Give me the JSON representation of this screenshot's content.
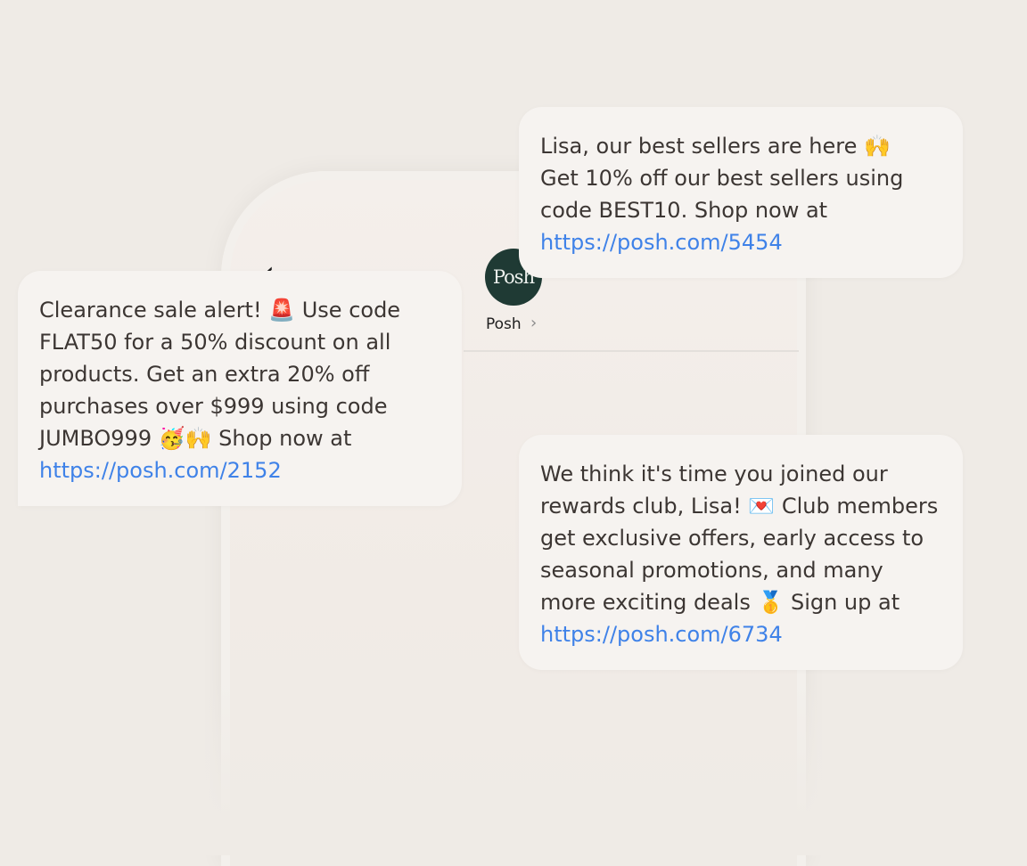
{
  "contact": {
    "avatar_text": "Posh",
    "name": "Posh",
    "chevron": "›",
    "back": "‹"
  },
  "messages": [
    {
      "lines": [
        "Lisa, our best sellers are here 🙌",
        "Get 10% off our best sellers using",
        "code BEST10. Shop now at"
      ],
      "link": "https://posh.com/5454"
    },
    {
      "lines": [
        "Clearance sale alert! 🚨 Use code",
        "FLAT50 for a 50% discount on all",
        "products. Get an extra 20% off",
        "purchases over $999 using code",
        "JUMBO999 🥳🙌 Shop now at"
      ],
      "link": "https://posh.com/2152"
    },
    {
      "lines": [
        "We think it's time you joined our",
        "rewards club, Lisa! 💌 Club members",
        "get exclusive offers, early access to",
        "seasonal promotions, and many",
        "more exciting deals 🥇 Sign up at"
      ],
      "link": "https://posh.com/6734"
    }
  ],
  "colors": {
    "background": "#efebe6",
    "bubble": "#f6f3f0",
    "link": "#3f82e8",
    "avatar": "#1f3a34"
  },
  "icons": {
    "back": "chevron-left-icon",
    "contact_more": "chevron-right-icon"
  }
}
